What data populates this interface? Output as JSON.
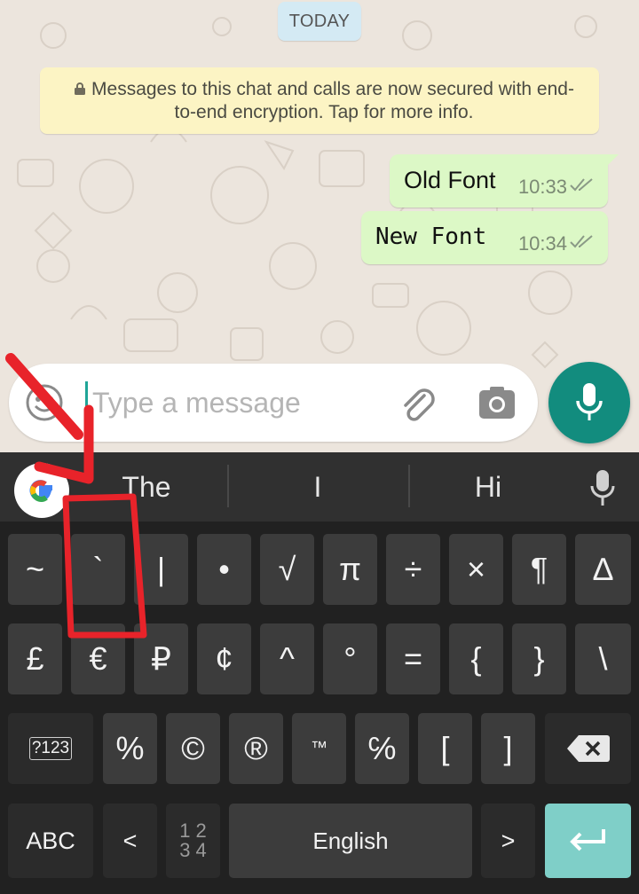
{
  "chat": {
    "date_chip": "TODAY",
    "encryption_notice": "Messages to this chat and calls are now secured with end-to-end encryption. Tap for more info.",
    "messages": [
      {
        "text": "Old Font",
        "time": "10:33"
      },
      {
        "text": "New Font",
        "time": "10:34"
      }
    ]
  },
  "composer": {
    "placeholder": "Type a message",
    "value": ""
  },
  "keyboard": {
    "suggestions": [
      "The",
      "I",
      "Hi"
    ],
    "row1": [
      "~",
      "`",
      "|",
      "•",
      "√",
      "π",
      "÷",
      "×",
      "¶",
      "∆"
    ],
    "row2": [
      "£",
      "€",
      "₽",
      "¢",
      "^",
      "°",
      "=",
      "{",
      "}",
      "\\"
    ],
    "row3": {
      "mode_key": "?123",
      "keys": [
        "%",
        "©",
        "®",
        "™",
        "℅",
        "[",
        "]"
      ]
    },
    "row4": {
      "abc": "ABC",
      "less_than": "<",
      "numpad_top": "1 2",
      "numpad_bottom": "3 4",
      "space": "English",
      "greater_than": ">"
    }
  },
  "colors": {
    "accent": "#128c7e",
    "outgoing_bubble": "#dcf8c6",
    "annotation": "#e8232a"
  }
}
